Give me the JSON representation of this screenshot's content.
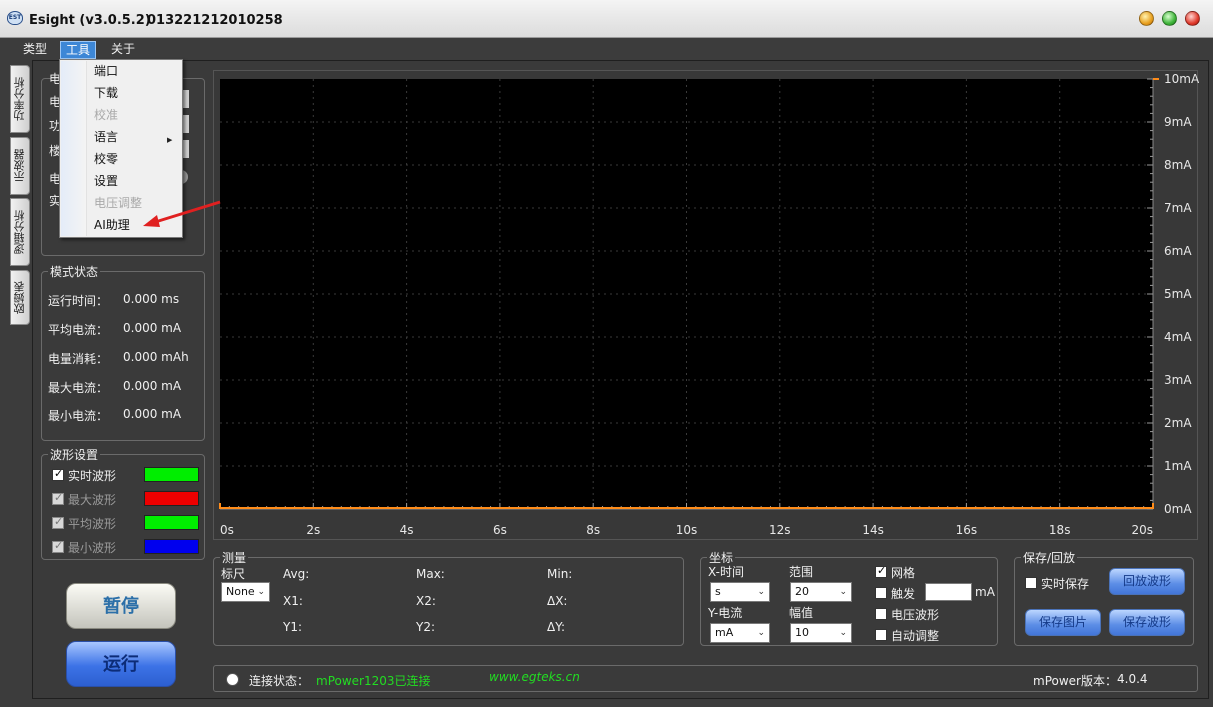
{
  "window": {
    "title": "Esight (v3.0.5.2)",
    "serial": "013221212010258",
    "icon": "esight-app-icon"
  },
  "menubar": {
    "type_label": "类型",
    "tools_label": "工具",
    "about_label": "关于"
  },
  "tools_menu": {
    "items": [
      {
        "label": "端口",
        "enabled": true
      },
      {
        "label": "下载",
        "enabled": true
      },
      {
        "label": "校准",
        "enabled": false
      },
      {
        "label": "语言",
        "enabled": true,
        "submenu": true
      },
      {
        "label": "校零",
        "enabled": true
      },
      {
        "label": "设置",
        "enabled": true
      },
      {
        "label": "电压调整",
        "enabled": false
      },
      {
        "label": "AI助理",
        "enabled": true
      }
    ]
  },
  "side_tabs": [
    "功率分析",
    "示波器",
    "逻辑分析",
    "欧姆表"
  ],
  "top_group": {
    "partial_labels": [
      "电",
      "电",
      "功",
      "楼",
      "电",
      "实"
    ]
  },
  "mode_status": {
    "title": "模式状态",
    "rows": [
      {
        "label": "运行时间：",
        "value": "0.000 ms"
      },
      {
        "label": "平均电流：",
        "value": "0.000 mA"
      },
      {
        "label": "电量消耗：",
        "value": "0.000 mAh"
      },
      {
        "label": "最大电流：",
        "value": "0.000 mA"
      },
      {
        "label": "最小电流：",
        "value": "0.000 mA"
      }
    ]
  },
  "waveform_settings": {
    "title": "波形设置",
    "items": [
      {
        "label": "实时波形",
        "checked": true,
        "enabled": true,
        "color": "#00ee00"
      },
      {
        "label": "最大波形",
        "checked": true,
        "enabled": false,
        "color": "#ee0000"
      },
      {
        "label": "平均波形",
        "checked": true,
        "enabled": false,
        "color": "#00ee00"
      },
      {
        "label": "最小波形",
        "checked": true,
        "enabled": false,
        "color": "#0000ee"
      }
    ]
  },
  "controls": {
    "pause_label": "暂停",
    "run_label": "运行"
  },
  "chart_data": {
    "type": "line",
    "x_ticks": [
      "0s",
      "2s",
      "4s",
      "6s",
      "8s",
      "10s",
      "12s",
      "14s",
      "16s",
      "18s",
      "20s"
    ],
    "y_ticks": [
      "0mA",
      "1mA",
      "2mA",
      "3mA",
      "4mA",
      "5mA",
      "6mA",
      "7mA",
      "8mA",
      "9mA",
      "10mA"
    ],
    "xlim": [
      0,
      20
    ],
    "ylim": [
      0,
      10
    ],
    "grid": true,
    "series": [
      {
        "color": "#ff8c1a",
        "x": [
          0,
          20
        ],
        "y": [
          0,
          0
        ]
      }
    ],
    "background": "#000000"
  },
  "measure": {
    "title": "测量",
    "ruler_label": "标尺",
    "ruler_value": "None",
    "avg_label": "Avg:",
    "max_label": "Max:",
    "min_label": "Min:",
    "x1_label": "X1:",
    "x2_label": "X2:",
    "dx_label": "ΔX:",
    "y1_label": "Y1:",
    "y2_label": "Y2:",
    "dy_label": "ΔY:"
  },
  "axes": {
    "title": "坐标",
    "x_time_label": "X-时间",
    "x_unit": "s",
    "range_label": "范围",
    "range_value": "20",
    "y_current_label": "Y-电流",
    "y_unit": "mA",
    "amplitude_label": "幅值",
    "amplitude_value": "10",
    "grid_label": "网格",
    "grid_checked": true,
    "trigger_label": "触发",
    "trigger_checked": false,
    "trigger_value": "",
    "trigger_unit": "mA",
    "voltage_wave_label": "电压波形",
    "voltage_wave_checked": false,
    "auto_adjust_label": "自动调整",
    "auto_adjust_checked": false
  },
  "save_playback": {
    "title": "保存/回放",
    "realtime_save_label": "实时保存",
    "realtime_save_checked": false,
    "playback_label": "回放波形",
    "save_image_label": "保存图片",
    "save_waveform_label": "保存波形"
  },
  "status": {
    "connection_label": "连接状态：",
    "connection_value": "mPower1203已连接",
    "website": "www.egteks.cn",
    "version_label": "mPower版本：",
    "version_value": "4.0.4",
    "accent_green": "#22dd22"
  }
}
